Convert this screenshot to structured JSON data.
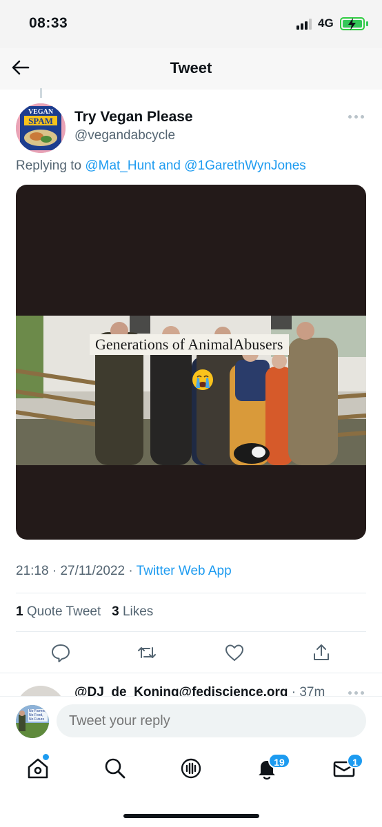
{
  "status_bar": {
    "time": "08:33",
    "network": "4G"
  },
  "header": {
    "title": "Tweet"
  },
  "tweet": {
    "author_name": "Try Vegan Please",
    "author_handle": "@vegandabcycle",
    "avatar_text_top": "VEGAN",
    "avatar_text_main": "SPAM",
    "replying_prefix": "Replying to",
    "mention_1": "@Mat_Hunt",
    "mention_joiner": "and",
    "mention_2": "@1GarethWynJones",
    "media_caption": "Generations of AnimalAbusers",
    "time": "21:18",
    "date": "27/11/2022",
    "separator": "·",
    "source_app": "Twitter Web App",
    "quote_count": "1",
    "quote_label": "Quote Tweet",
    "like_count": "3",
    "like_label": "Likes"
  },
  "actions": {
    "reply_icon": "reply-icon",
    "retweet_icon": "retweet-icon",
    "like_icon": "heart-icon",
    "share_icon": "share-icon"
  },
  "next_reply": {
    "user": "@DJ_de_Koning@fediscience.org",
    "time": "· 37m"
  },
  "composer": {
    "placeholder": "Tweet your reply",
    "avatar_text": "No Farmer, No Food, No Future"
  },
  "tabbar": {
    "notifications_badge": "19",
    "messages_badge": "1"
  },
  "colors": {
    "accent": "#1d9bf0",
    "text_primary": "#0f1419",
    "text_secondary": "#536471"
  }
}
